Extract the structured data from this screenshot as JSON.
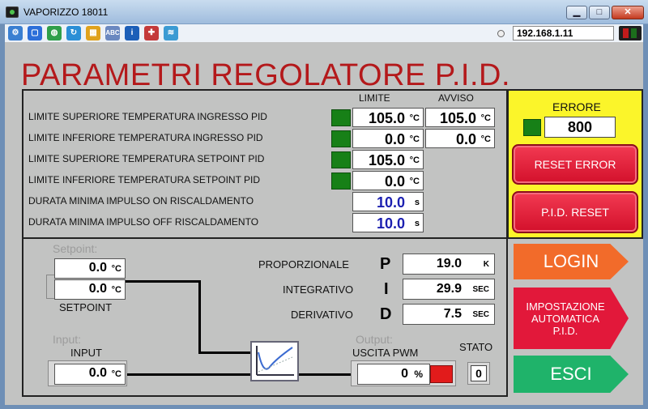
{
  "window": {
    "title": "VAPORIZZO 18011",
    "minimize": "▁",
    "maximize": "□",
    "close": "✕"
  },
  "toolbar": {
    "icons": [
      "network-icon",
      "window-icon",
      "globe-icon",
      "refresh-icon",
      "windows-icon",
      "spell-icon",
      "info-icon",
      "tools-icon",
      "signal-icon"
    ],
    "ip_address": "192.168.1.11"
  },
  "page_title": "PARAMETRI REGOLATORE P.I.D.",
  "params": {
    "header_limit": "LIMITE",
    "header_warning": "AVVISO",
    "rows": [
      {
        "label": "LIMITE SUPERIORE TEMPERATURA INGRESSO PID",
        "limit": "105.0",
        "limit_unit": "°C",
        "warning": "105.0",
        "warning_unit": "°C"
      },
      {
        "label": "LIMITE INFERIORE TEMPERATURA INGRESSO PID",
        "limit": "0.0",
        "limit_unit": "°C",
        "warning": "0.0",
        "warning_unit": "°C"
      },
      {
        "label": "LIMITE SUPERIORE TEMPERATURA SETPOINT PID",
        "limit": "105.0",
        "limit_unit": "°C"
      },
      {
        "label": "LIMITE INFERIORE TEMPERATURA SETPOINT PID",
        "limit": "0.0",
        "limit_unit": "°C"
      },
      {
        "label": "DURATA MINIMA IMPULSO ON RISCALDAMENTO",
        "limit": "10.0",
        "limit_unit": "s"
      },
      {
        "label": "DURATA MINIMA IMPULSO OFF RISCALDAMENTO",
        "limit": "10.0",
        "limit_unit": "s"
      }
    ]
  },
  "error": {
    "label": "ERRORE",
    "value": "800",
    "reset_error": "RESET ERROR",
    "pid_reset": "P.I.D. RESET"
  },
  "pid": {
    "setpoint_ghost": "Setpoint:",
    "setpoint_value1": "0.0",
    "setpoint_value2": "0.0",
    "setpoint_unit": "°C",
    "setpoint_label": "SETPOINT",
    "input_ghost": "Input:",
    "input_label": "INPUT",
    "input_value": "0.0",
    "input_unit": "°C",
    "output_ghost": "Output:",
    "output_label": "USCITA PWM",
    "output_value": "0",
    "output_unit": "%",
    "state_label": "STATO",
    "state_value": "0",
    "terms": [
      {
        "label": "PROPORZIONALE",
        "letter": "P",
        "value": "19.0",
        "unit": "K"
      },
      {
        "label": "INTEGRATIVO",
        "letter": "I",
        "value": "29.9",
        "unit": "SEC"
      },
      {
        "label": "DERIVATIVO",
        "letter": "D",
        "value": "7.5",
        "unit": "SEC"
      }
    ]
  },
  "buttons": {
    "login": "LOGIN",
    "auto_line1": "IMPOSTAZIONE",
    "auto_line2": "AUTOMATICA",
    "auto_line3": "P.I.D.",
    "esci": "ESCI"
  },
  "colors": {
    "title_red": "#b4191b",
    "indicator_green": "#178017",
    "error_panel": "#fbf52a",
    "login": "#f26b2a",
    "auto": "#e2183a",
    "esci": "#1fb36a"
  }
}
